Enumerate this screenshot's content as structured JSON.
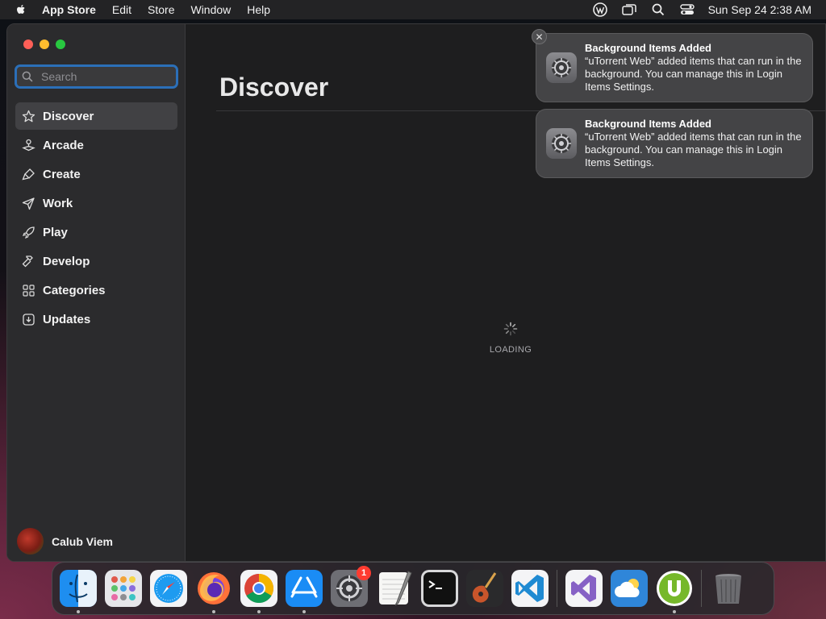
{
  "menubar": {
    "app_name": "App Store",
    "menus": [
      "Edit",
      "Store",
      "Window",
      "Help"
    ],
    "clock": "Sun Sep 24  2:38 AM"
  },
  "sidebar": {
    "search_placeholder": "Search",
    "items": [
      {
        "label": "Discover",
        "icon": "star-icon",
        "active": true
      },
      {
        "label": "Arcade",
        "icon": "joystick-icon"
      },
      {
        "label": "Create",
        "icon": "brush-icon"
      },
      {
        "label": "Work",
        "icon": "paper-plane-icon"
      },
      {
        "label": "Play",
        "icon": "rocket-icon"
      },
      {
        "label": "Develop",
        "icon": "hammer-icon"
      },
      {
        "label": "Categories",
        "icon": "grid-icon"
      },
      {
        "label": "Updates",
        "icon": "download-icon"
      }
    ],
    "account_name": "Calub Viem"
  },
  "main": {
    "title": "Discover",
    "loading_label": "LOADING"
  },
  "notifications": [
    {
      "title": "Background Items Added",
      "body": "“uTorrent Web” added items that can run in the background. You can manage this in Login Items Settings."
    },
    {
      "title": "Background Items Added",
      "body": "“uTorrent Web” added items that can run in the background. You can manage this in Login Items Settings."
    }
  ],
  "dock": {
    "apps": [
      {
        "name": "Finder",
        "icon": "finder-icon",
        "running": true
      },
      {
        "name": "Launchpad",
        "icon": "launchpad-icon",
        "running": false
      },
      {
        "name": "Safari",
        "icon": "safari-icon",
        "running": false
      },
      {
        "name": "Firefox",
        "icon": "firefox-icon",
        "running": true
      },
      {
        "name": "Chrome",
        "icon": "chrome-icon",
        "running": true
      },
      {
        "name": "App Store",
        "icon": "app-store-icon",
        "running": true
      },
      {
        "name": "System Settings",
        "icon": "system-settings-icon",
        "running": false,
        "badge": "1"
      },
      {
        "name": "TextEdit",
        "icon": "textedit-icon",
        "running": false
      },
      {
        "name": "Terminal",
        "icon": "terminal-icon",
        "running": false
      },
      {
        "name": "GarageBand",
        "icon": "garageband-icon",
        "running": false
      },
      {
        "name": "Visual Studio Code",
        "icon": "vscode-icon",
        "running": false
      },
      {
        "name": "Visual Studio",
        "icon": "visual-studio-icon",
        "running": false
      },
      {
        "name": "Weather",
        "icon": "weather-icon",
        "running": false
      },
      {
        "name": "uTorrent Web",
        "icon": "utorrent-icon",
        "running": true
      },
      {
        "name": "Trash",
        "icon": "trash-icon",
        "running": false
      }
    ]
  },
  "colors": {
    "accent": "#2b6fb8",
    "badge": "#ff3b30",
    "utorrent": "#76b82a"
  }
}
